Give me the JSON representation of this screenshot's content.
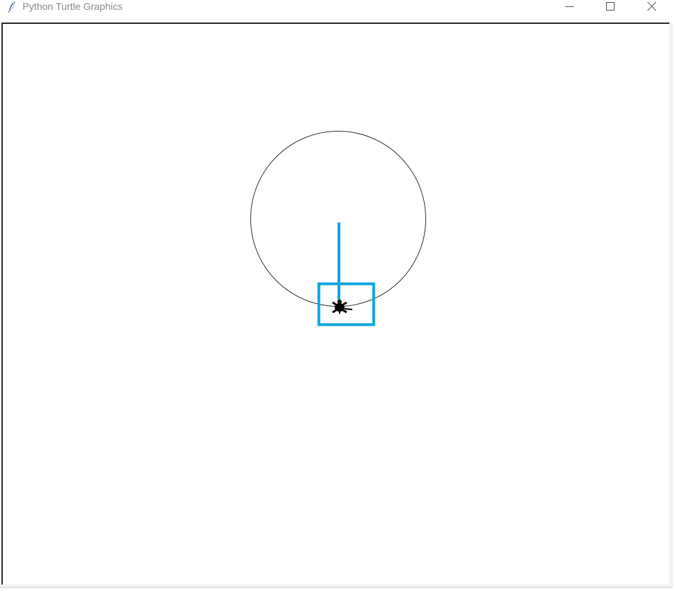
{
  "window": {
    "title": "Python Turtle Graphics",
    "app_icon": "feather-icon"
  },
  "controls": {
    "minimize_icon": "minimize-icon",
    "maximize_icon": "maximize-icon",
    "close_icon": "close-icon"
  },
  "canvas": {
    "background": "#ffffff",
    "circle_stroke": "#333333",
    "turtle_color": "#000000",
    "annotation_color": "#0ea5e0"
  }
}
